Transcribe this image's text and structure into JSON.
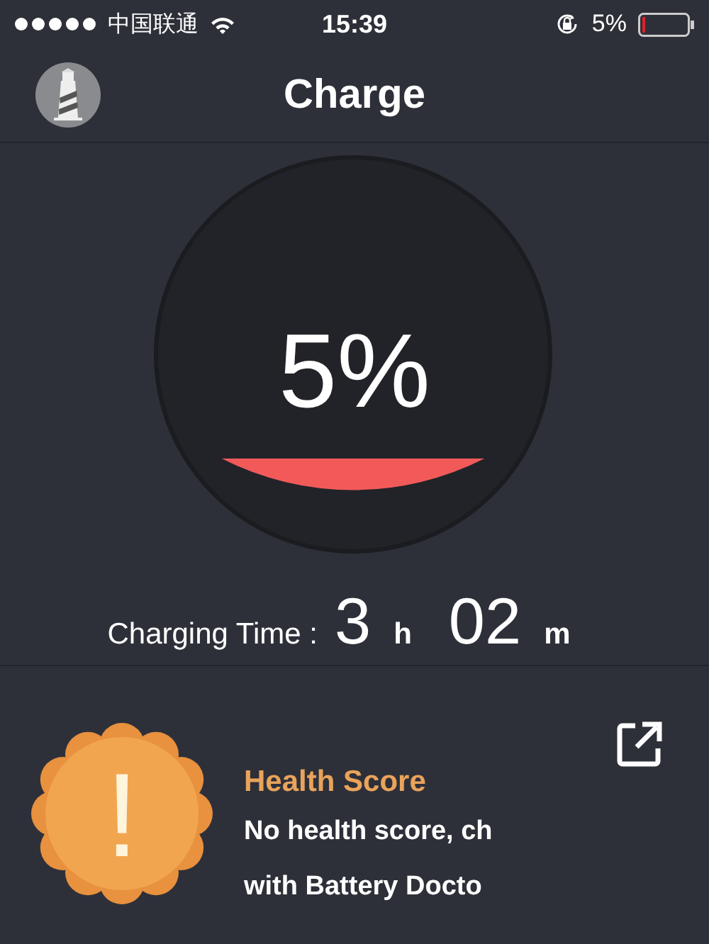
{
  "status_bar": {
    "carrier": "中国联通",
    "time": "15:39",
    "battery": "5%"
  },
  "nav": {
    "title": "Charge"
  },
  "charge": {
    "percent": "5%"
  },
  "charging_time": {
    "label": "Charging Time :",
    "hours": "3",
    "hours_unit": "h",
    "minutes": "02",
    "minutes_unit": "m"
  },
  "health": {
    "title": "Health Score",
    "badge": "!",
    "lines": [
      "No health score, ch",
      "with Battery Docto"
    ]
  }
}
